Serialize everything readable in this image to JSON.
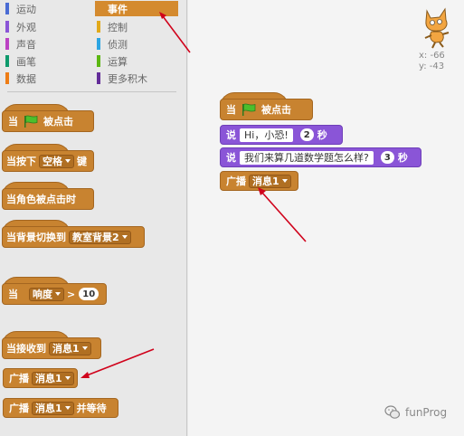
{
  "categories": [
    {
      "label": "运动",
      "color": "#4a6cd4"
    },
    {
      "label": "外观",
      "color": "#8a55d7"
    },
    {
      "label": "声音",
      "color": "#bb42c3"
    },
    {
      "label": "画笔",
      "color": "#0e9a6c"
    },
    {
      "label": "数据",
      "color": "#ee7d16"
    },
    {
      "label": "事件",
      "color": "#c88330",
      "active": true
    },
    {
      "label": "控制",
      "color": "#e1a91a"
    },
    {
      "label": "侦测",
      "color": "#2ca5e2"
    },
    {
      "label": "运算",
      "color": "#5cb712"
    },
    {
      "label": "更多积木",
      "color": "#632d99"
    }
  ],
  "palette": {
    "when_flag": {
      "pre": "当",
      "post": "被点击"
    },
    "when_key": {
      "pre": "当按下",
      "key": "空格",
      "post": "键"
    },
    "when_sprite_clicked": {
      "label": "当角色被点击时"
    },
    "when_backdrop": {
      "pre": "当背景切换到",
      "backdrop": "教室背景2"
    },
    "when_sensor": {
      "pre": "当",
      "sensor": "响度",
      "op": ">",
      "value": "10"
    },
    "when_receive": {
      "pre": "当接收到",
      "msg": "消息1"
    },
    "broadcast": {
      "pre": "广播",
      "msg": "消息1"
    },
    "broadcast_wait": {
      "pre": "广播",
      "msg": "消息1",
      "post": "并等待"
    }
  },
  "script": {
    "hat": {
      "pre": "当",
      "post": "被点击"
    },
    "say1": {
      "pre": "说",
      "text": "Hi，小恐!",
      "secs": "2",
      "post": "秒"
    },
    "say2": {
      "pre": "说",
      "text": "我们来算几道数学题怎么样?",
      "secs": "3",
      "post": "秒"
    },
    "broadcast": {
      "pre": "广播",
      "msg": "消息1"
    }
  },
  "sprite_info": {
    "x": "x: -66",
    "y": "y: -43"
  },
  "watermark": "funProg",
  "colors": {
    "events": "#c88330",
    "looks": "#8a55d7",
    "arrow": "#d0021b"
  }
}
